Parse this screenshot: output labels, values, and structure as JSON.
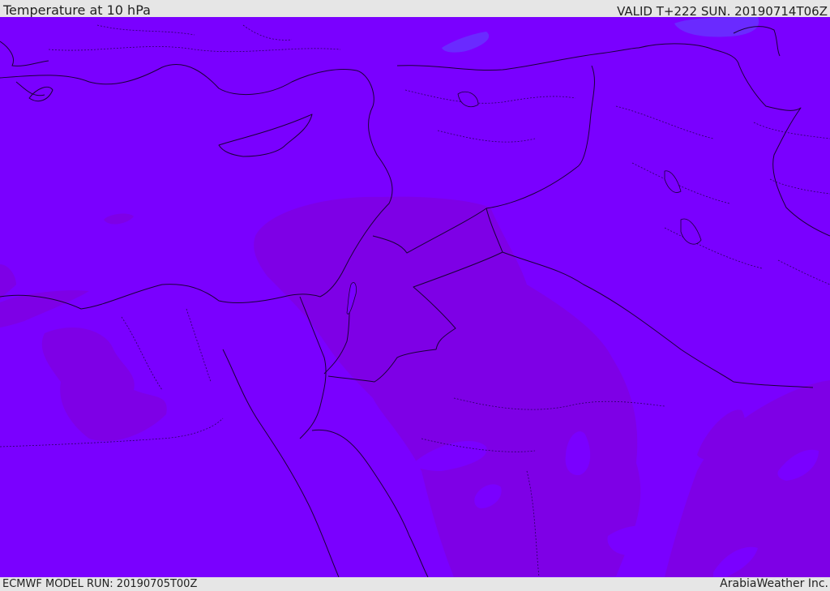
{
  "header": {
    "title": "Temperature at 10 hPa",
    "valid": "VALID T+222 SUN. 20190714T06Z"
  },
  "footer": {
    "model_run": "ECMWF MODEL RUN: 20190705T00Z",
    "credit": "ArabiaWeather Inc."
  },
  "map": {
    "colors": {
      "field_base": "#7a00ff",
      "field_warm": "#7e00e6",
      "field_cool": "#6a2aff",
      "border": "#1b0038",
      "admin_border": "#2a0060"
    }
  }
}
